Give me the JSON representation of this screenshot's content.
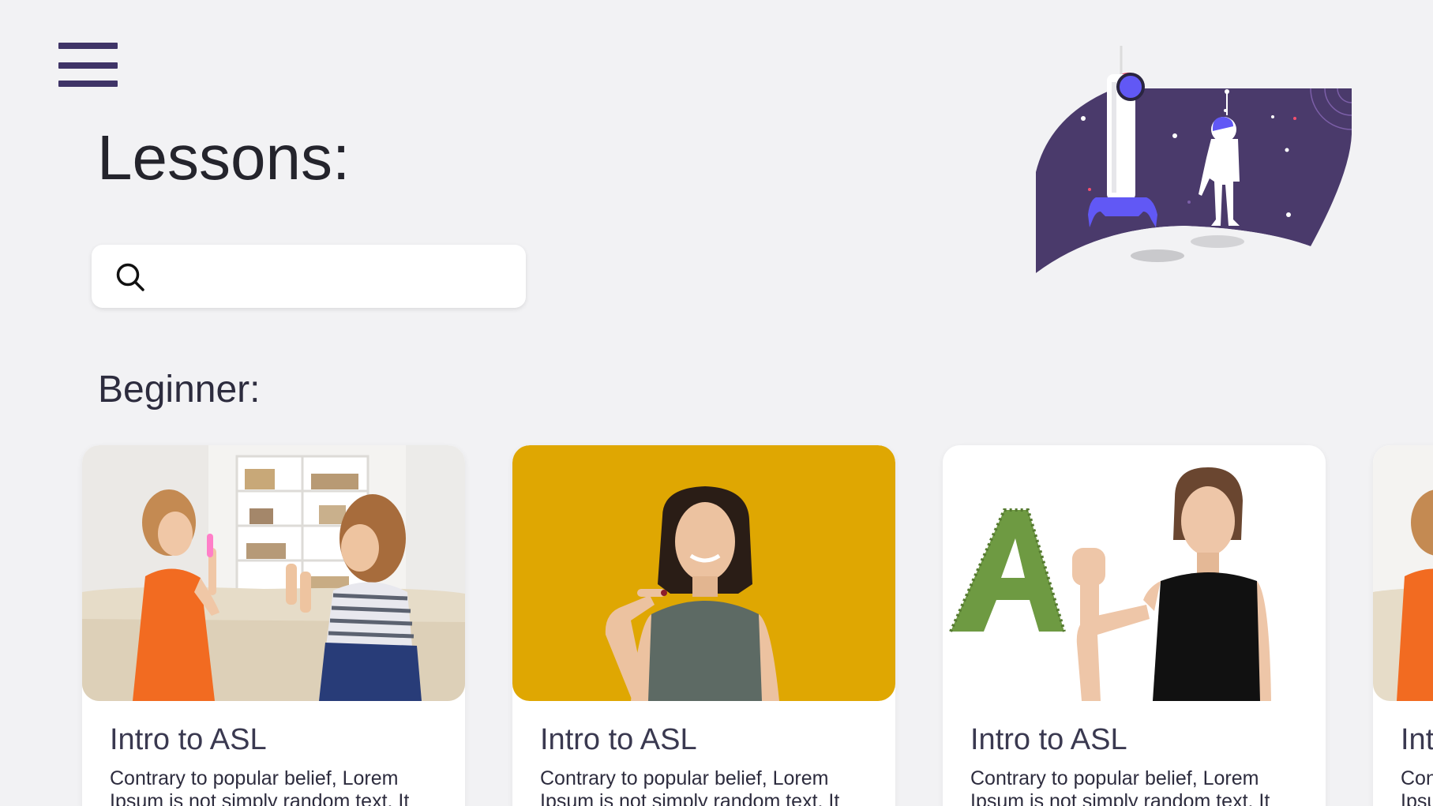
{
  "header": {
    "menu_icon": "hamburger-menu-icon",
    "title": "Lessons:"
  },
  "search": {
    "icon": "search-icon",
    "value": "",
    "placeholder": ""
  },
  "hero": {
    "illustration": "rocket-astronaut-illustration",
    "colors": {
      "space": "#4a3a6b",
      "accent": "#6158f5",
      "pink": "#f4506e"
    }
  },
  "sections": [
    {
      "title": "Beginner:",
      "cards": [
        {
          "title": "Intro to ASL",
          "description": "Contrary to popular belief, Lorem Ipsum is not simply random text. It",
          "image": "two-women-signing-photo"
        },
        {
          "title": "Intro to ASL",
          "description": "Contrary to popular belief, Lorem Ipsum is not simply random text. It",
          "image": "woman-pointing-yellow-background-photo"
        },
        {
          "title": "Intro to ASL",
          "description": "Contrary to popular belief, Lorem Ipsum is not simply random text. It",
          "image": "girl-signing-letter-a-photo"
        },
        {
          "title": "Intro to ASL",
          "description": "Contrary to popular belief, Lorem Ipsum is not simply random text. It",
          "image": "two-women-signing-photo"
        }
      ]
    }
  ],
  "colors": {
    "background": "#f2f2f4",
    "menu": "#3f3467",
    "card_yellow": "#dfa702"
  }
}
